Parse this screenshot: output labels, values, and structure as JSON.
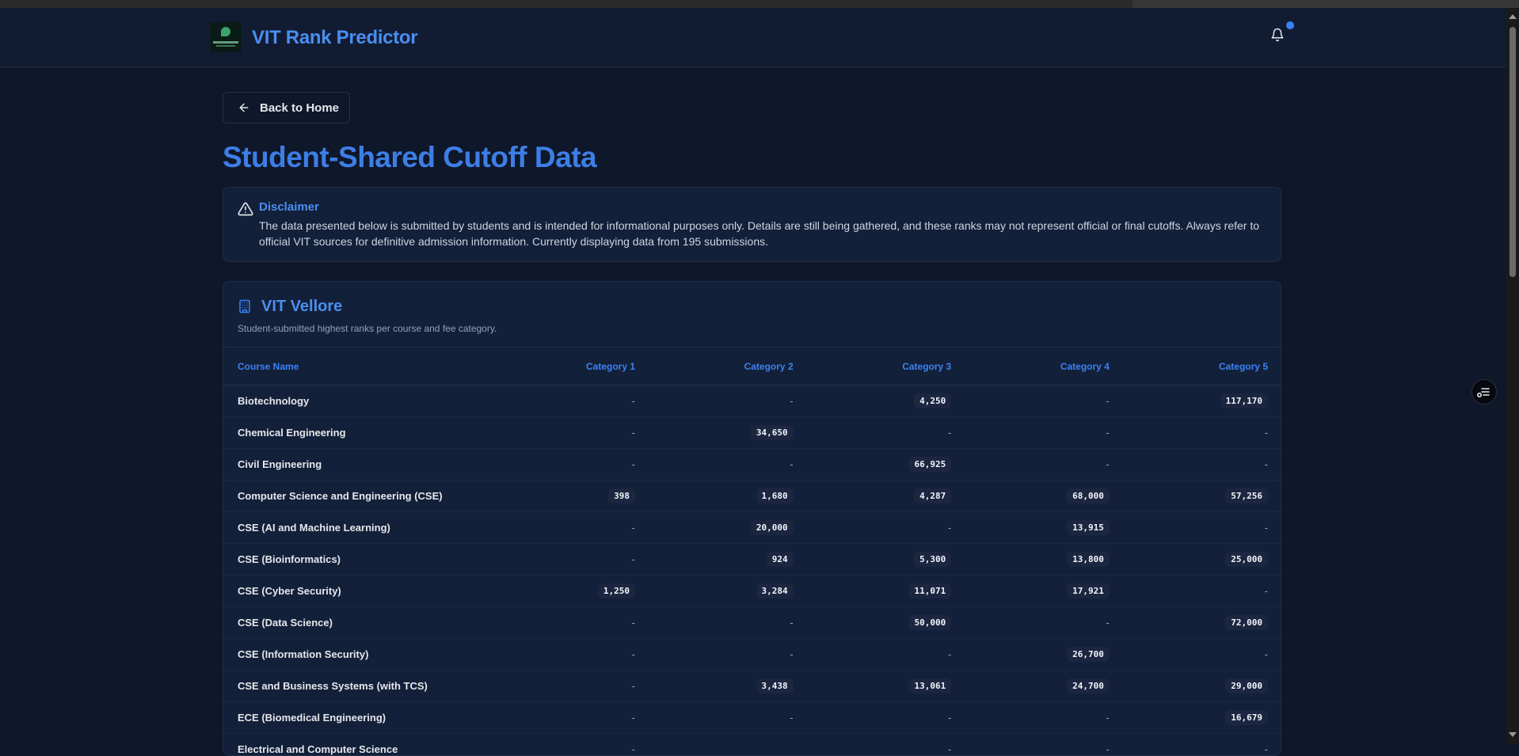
{
  "header": {
    "app_title": "VIT Rank Predictor",
    "notification_count_visible": true
  },
  "nav": {
    "back_label": "Back to Home"
  },
  "page": {
    "title": "Student-Shared Cutoff Data"
  },
  "disclaimer": {
    "title": "Disclaimer",
    "text": "The data presented below is submitted by students and is intended for informational purposes only. Details are still being gathered, and these ranks may not represent official or final cutoffs. Always refer to official VIT sources for definitive admission information. Currently displaying data from 195 submissions."
  },
  "campus": {
    "name": "VIT Vellore",
    "subtitle": "Student-submitted highest ranks per course and fee category.",
    "columns": [
      "Course Name",
      "Category 1",
      "Category 2",
      "Category 3",
      "Category 4",
      "Category 5"
    ],
    "rows": [
      {
        "course": "Biotechnology",
        "values": [
          "-",
          "-",
          "4,250",
          "-",
          "117,170"
        ]
      },
      {
        "course": "Chemical Engineering",
        "values": [
          "-",
          "34,650",
          "-",
          "-",
          "-"
        ]
      },
      {
        "course": "Civil Engineering",
        "values": [
          "-",
          "-",
          "66,925",
          "-",
          "-"
        ]
      },
      {
        "course": "Computer Science and Engineering (CSE)",
        "values": [
          "398",
          "1,680",
          "4,287",
          "68,000",
          "57,256"
        ]
      },
      {
        "course": "CSE (AI and Machine Learning)",
        "values": [
          "-",
          "20,000",
          "-",
          "13,915",
          "-"
        ]
      },
      {
        "course": "CSE (Bioinformatics)",
        "values": [
          "-",
          "924",
          "5,300",
          "13,800",
          "25,000"
        ]
      },
      {
        "course": "CSE (Cyber Security)",
        "values": [
          "1,250",
          "3,284",
          "11,071",
          "17,921",
          "-"
        ]
      },
      {
        "course": "CSE (Data Science)",
        "values": [
          "-",
          "-",
          "50,000",
          "-",
          "72,000"
        ]
      },
      {
        "course": "CSE (Information Security)",
        "values": [
          "-",
          "-",
          "-",
          "26,700",
          "-"
        ]
      },
      {
        "course": "CSE and Business Systems (with TCS)",
        "values": [
          "-",
          "3,438",
          "13,061",
          "24,700",
          "29,000"
        ]
      },
      {
        "course": "ECE (Biomedical Engineering)",
        "values": [
          "-",
          "-",
          "-",
          "-",
          "16,679"
        ]
      },
      {
        "course": "Electrical and Computer Science",
        "values": [
          "-",
          "",
          "-",
          "-",
          "-"
        ]
      }
    ]
  },
  "colors": {
    "accent": "#3b82f6",
    "background": "#0f172a",
    "card": "#132039"
  }
}
